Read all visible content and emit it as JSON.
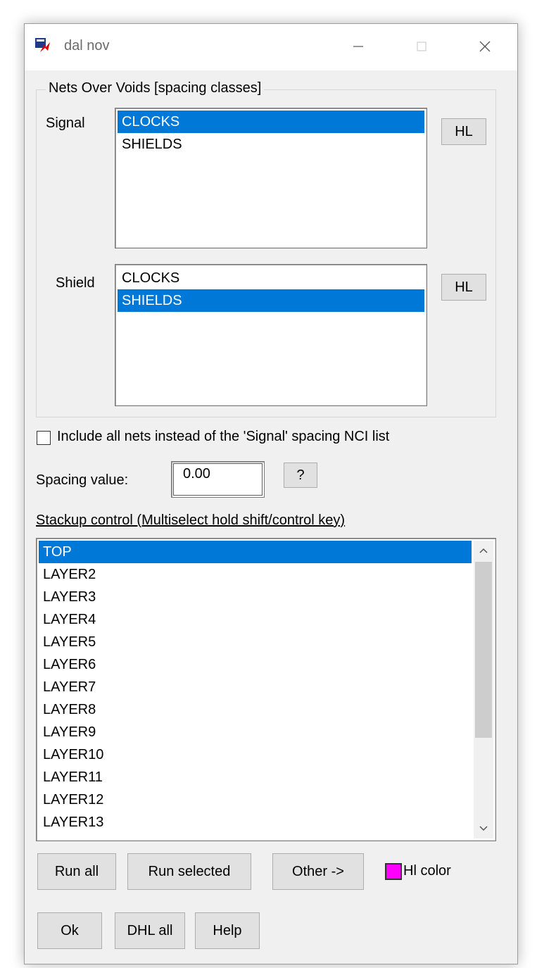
{
  "window": {
    "title": "dal nov",
    "minimize_glyph": "—",
    "maximize_glyph": "☐",
    "close_glyph": "✕"
  },
  "group": {
    "title": "Nets Over Voids [spacing classes]",
    "signal_label": "Signal",
    "signal_items": [
      {
        "label": "CLOCKS",
        "selected": true
      },
      {
        "label": "SHIELDS",
        "selected": false
      }
    ],
    "signal_hl_label": "HL",
    "shield_label": "Shield",
    "shield_items": [
      {
        "label": "CLOCKS",
        "selected": false
      },
      {
        "label": "SHIELDS",
        "selected": true
      }
    ],
    "shield_hl_label": "HL"
  },
  "include_all_nets": {
    "label": "Include all nets instead of the 'Signal' spacing NCI list",
    "checked": false
  },
  "spacing": {
    "label": "Spacing value:",
    "value": "0.00",
    "help_label": "?"
  },
  "stackup": {
    "label": "Stackup control (Multiselect hold shift/control key)",
    "layers": [
      {
        "label": "TOP",
        "selected": true
      },
      {
        "label": "LAYER2",
        "selected": false
      },
      {
        "label": "LAYER3",
        "selected": false
      },
      {
        "label": "LAYER4",
        "selected": false
      },
      {
        "label": "LAYER5",
        "selected": false
      },
      {
        "label": "LAYER6",
        "selected": false
      },
      {
        "label": "LAYER7",
        "selected": false
      },
      {
        "label": "LAYER8",
        "selected": false
      },
      {
        "label": "LAYER9",
        "selected": false
      },
      {
        "label": "LAYER10",
        "selected": false
      },
      {
        "label": "LAYER11",
        "selected": false
      },
      {
        "label": "LAYER12",
        "selected": false
      },
      {
        "label": "LAYER13",
        "selected": false
      }
    ]
  },
  "actions": {
    "run_all": "Run all",
    "run_selected": "Run selected",
    "other": "Other ->",
    "hl_color_label": "Hl color",
    "hl_color": "#ff00ff"
  },
  "footer": {
    "ok": "Ok",
    "dhl_all": "DHL all",
    "help": "Help"
  },
  "colors": {
    "selection": "#0078d7",
    "dialog_bg": "#f0f0f0"
  }
}
